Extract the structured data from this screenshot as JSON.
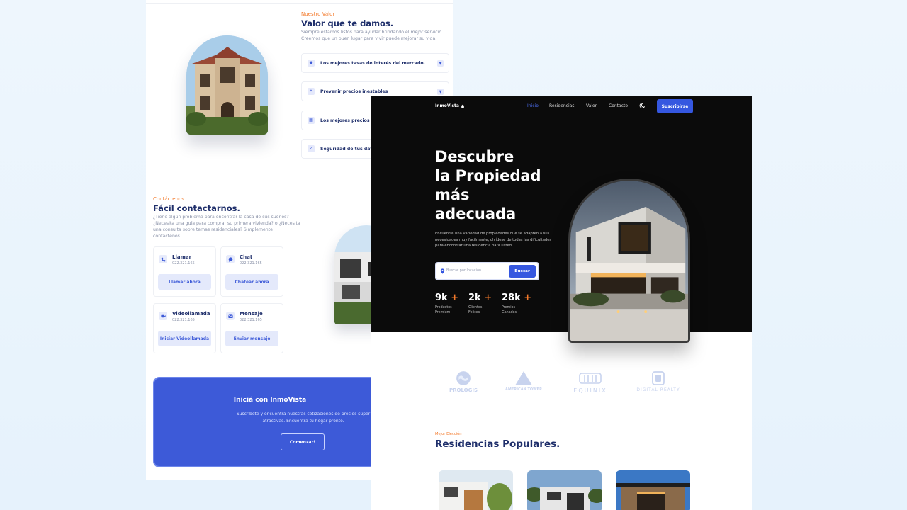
{
  "back_page": {
    "value_section": {
      "eyebrow": "Nuestro Valor",
      "title": "Valor que te damos.",
      "description": "Siempre estamos listos para ayudar brindando el mejor servicio. Creemos que un buen lugar para vivir puede mejorar su vida.",
      "accordion": [
        {
          "label": "Los mejores tasas de interés del mercado.",
          "icon": "shield-icon"
        },
        {
          "label": "Prevenir precios inestables",
          "icon": "x-square-icon"
        },
        {
          "label": "Los mejores precios del",
          "icon": "chart-icon"
        },
        {
          "label": "Seguridad de tus datos",
          "icon": "check-square-icon"
        }
      ]
    },
    "contact_section": {
      "eyebrow": "Contáctenos",
      "title": "Fácil contactarnos.",
      "description": "¿Tiene algún problema para encontrar la casa de sus sueños? ¿Necesita una guía para comprar su primera vivienda? o ¿Necesita una consulta sobre temas residenciales? Simplemente contáctenos.",
      "cards": [
        {
          "title": "Llamar",
          "number": "022.321.165",
          "button": "Llamar ahora",
          "icon": "phone-icon"
        },
        {
          "title": "Chat",
          "number": "022.321.165",
          "button": "Chatear ahora",
          "icon": "chat-icon"
        },
        {
          "title": "Videollamada",
          "number": "022.321.165",
          "button": "Iniciar Videollamada",
          "icon": "video-icon"
        },
        {
          "title": "Mensaje",
          "number": "022.321.165",
          "button": "Enviar mensaje",
          "icon": "mail-icon"
        }
      ]
    },
    "cta": {
      "title": "Iniciá con InmoVista",
      "text": "Suscríbete y encuentra nuestras cotizaciones de precios súper atractivas. Encuentra tu hogar pronto.",
      "button": "Comenzar!"
    }
  },
  "front_page": {
    "nav": {
      "logo": "InmoVista",
      "logo_icon": "home-icon",
      "links": [
        "Inicio",
        "Residencias",
        "Valor",
        "Contacto"
      ],
      "active_link": "Inicio",
      "theme_icon": "moon-icon",
      "subscribe": "Suscribirse"
    },
    "hero": {
      "title_lines": [
        "Descubre",
        "la Propiedad",
        "más",
        "adecuada"
      ],
      "description": "Encuentre una variedad de propiedades que se adapten a sus necesidades muy fácilmente, olvídese de todas las dificultades para encontrar una residencia para usted.",
      "search_placeholder": "Buscar por locación...",
      "search_button": "Buscar",
      "stats": [
        {
          "number": "9k",
          "plus": "+",
          "label_1": "Productos",
          "label_2": "Premium"
        },
        {
          "number": "2k",
          "plus": "+",
          "label_1": "Clientes",
          "label_2": "Felices"
        },
        {
          "number": "28k",
          "plus": "+",
          "label_1": "Premios",
          "label_2": "Ganados"
        }
      ]
    },
    "brands": [
      "PROLOGIS",
      "AMERICAN TOWER",
      "EQUINIX",
      "DIGITAL REALTY"
    ],
    "popular": {
      "eyebrow": "Mejor Elección",
      "title": "Residencias Populares."
    }
  },
  "colors": {
    "accent_blue": "#3557e0",
    "accent_orange": "#f37a2b",
    "heading_navy": "#1f2f6b",
    "hero_bg": "#0b0b0b",
    "page_bg": "#eaf4fc"
  }
}
